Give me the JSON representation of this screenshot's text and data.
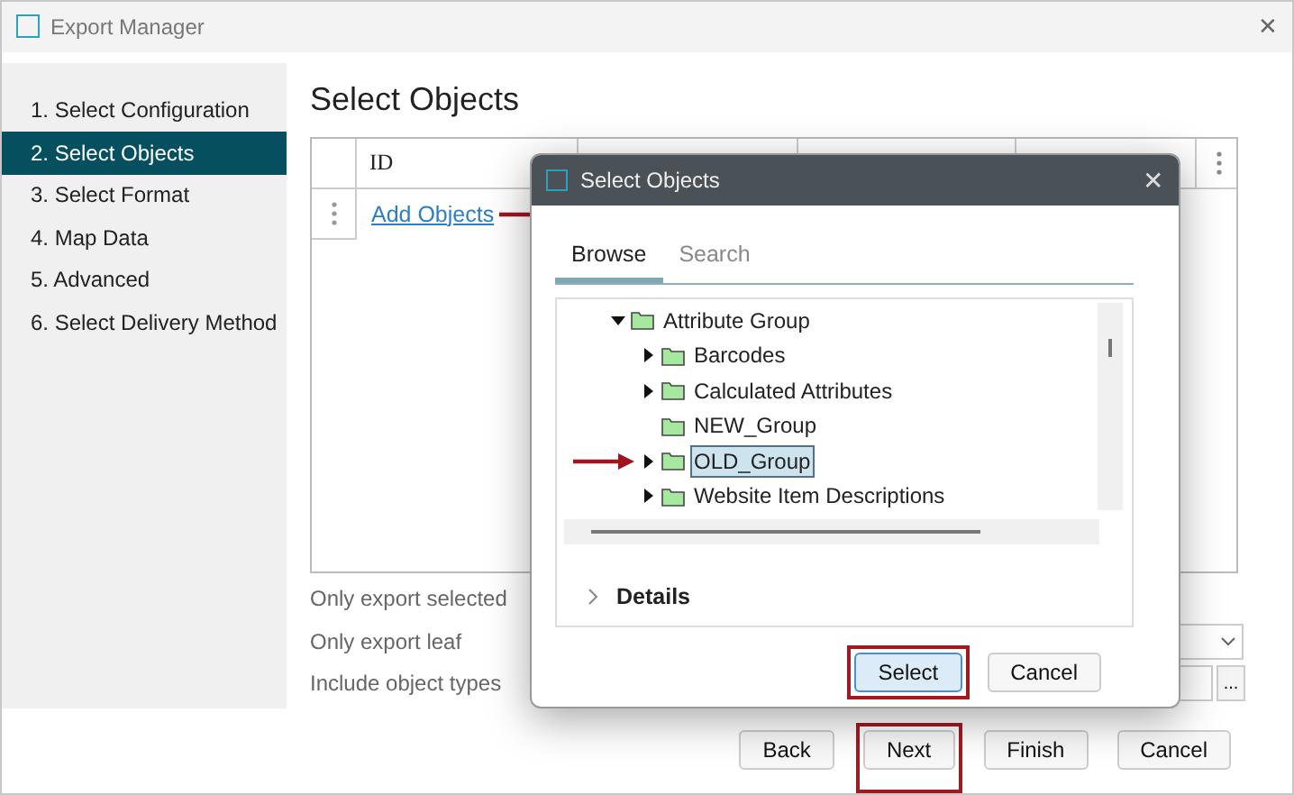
{
  "window": {
    "title": "Export Manager",
    "close": "✕"
  },
  "steps": [
    {
      "label": "1. Select Configuration",
      "selected": false
    },
    {
      "label": "2. Select Objects",
      "selected": true
    },
    {
      "label": "3. Select Format",
      "selected": false
    },
    {
      "label": "4. Map Data",
      "selected": false
    },
    {
      "label": "5. Advanced",
      "selected": false
    },
    {
      "label": "6. Select Delivery Method",
      "selected": false
    }
  ],
  "heading": "Select Objects",
  "table": {
    "columns": [
      "ID"
    ],
    "add_link": {
      "label": "Add Objects",
      "marked": true
    }
  },
  "options": [
    "Only export selected",
    "Only export leaf",
    "Include object types"
  ],
  "browse_button": "...",
  "buttons": [
    {
      "label": "Back",
      "highlighted": false
    },
    {
      "label": "Next",
      "highlighted": true
    },
    {
      "label": "Finish",
      "highlighted": false
    },
    {
      "label": "Cancel",
      "highlighted": false
    }
  ],
  "dialog": {
    "title": "Select Objects",
    "close": "✕",
    "tabs": [
      {
        "label": "Browse",
        "selected": true
      },
      {
        "label": "Search",
        "selected": false
      }
    ],
    "tree": [
      {
        "label": "Attribute Group",
        "expanded": true,
        "selected": false,
        "marked": false,
        "children": [
          {
            "label": "Barcodes",
            "expanded": false,
            "selected": false,
            "marked": false
          },
          {
            "label": "Calculated Attributes",
            "expanded": false,
            "selected": false,
            "marked": false
          },
          {
            "label": "NEW_Group",
            "selected": false,
            "marked": false
          },
          {
            "label": "OLD_Group",
            "expanded": false,
            "selected": true,
            "marked": true
          },
          {
            "label": "Website Item Descriptions",
            "expanded": false,
            "selected": false,
            "marked": false
          }
        ]
      }
    ],
    "details": {
      "label": "Details",
      "expanded": false
    },
    "buttons": [
      {
        "label": "Select",
        "highlighted": true
      },
      {
        "label": "Cancel",
        "highlighted": false
      }
    ]
  }
}
